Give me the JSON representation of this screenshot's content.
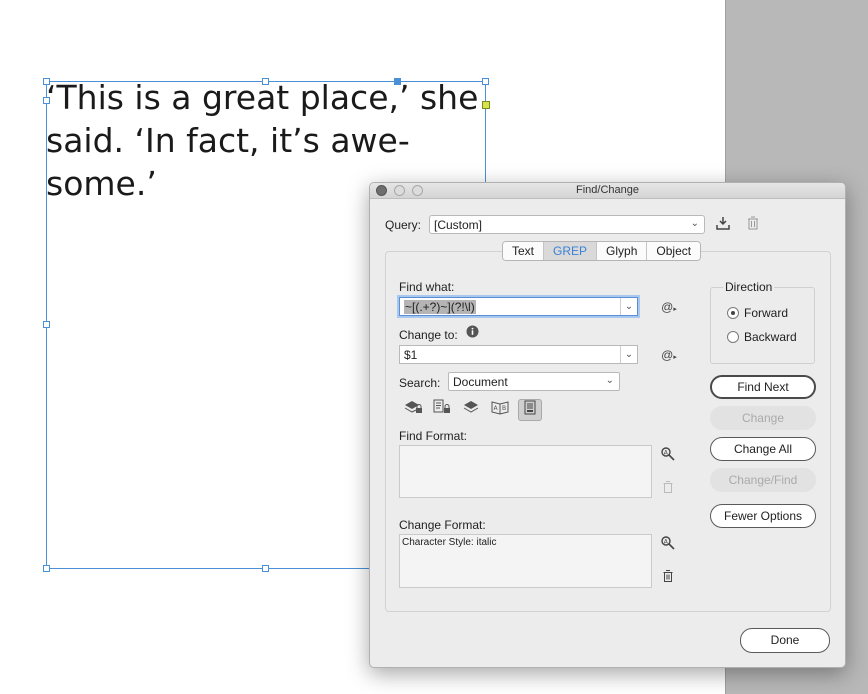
{
  "document": {
    "story_text": "‘This is a great place,’ she\nsaid. ‘In fact, it’s awe-\nsome.’"
  },
  "dialog": {
    "title": "Find/Change",
    "query": {
      "label": "Query:",
      "value": "[Custom]"
    },
    "tabs": [
      {
        "label": "Text",
        "active": false
      },
      {
        "label": "GREP",
        "active": true
      },
      {
        "label": "Glyph",
        "active": false
      },
      {
        "label": "Object",
        "active": false
      }
    ],
    "find_what": {
      "label": "Find what:",
      "value": "~[(.+?)~](?!\\l)"
    },
    "change_to": {
      "label": "Change to:",
      "value": "$1"
    },
    "search": {
      "label": "Search:",
      "value": "Document"
    },
    "find_format": {
      "label": "Find Format:",
      "value": ""
    },
    "change_format": {
      "label": "Change Format:",
      "value": "Character Style: italic"
    },
    "direction": {
      "label": "Direction",
      "options": [
        {
          "label": "Forward",
          "selected": true
        },
        {
          "label": "Backward",
          "selected": false
        }
      ]
    },
    "buttons": {
      "find_next": "Find Next",
      "change": "Change",
      "change_all": "Change All",
      "change_find": "Change/Find",
      "fewer_options": "Fewer Options",
      "done": "Done"
    },
    "icons": {
      "save_query": "save-query-icon",
      "delete_query": "trash-icon",
      "special_chars": "@",
      "info": "info-icon",
      "search_icons": [
        "include-locked-layers-icon",
        "include-locked-stories-icon",
        "include-hidden-layers-icon",
        "include-master-pages-icon",
        "include-footnotes-icon"
      ]
    }
  }
}
